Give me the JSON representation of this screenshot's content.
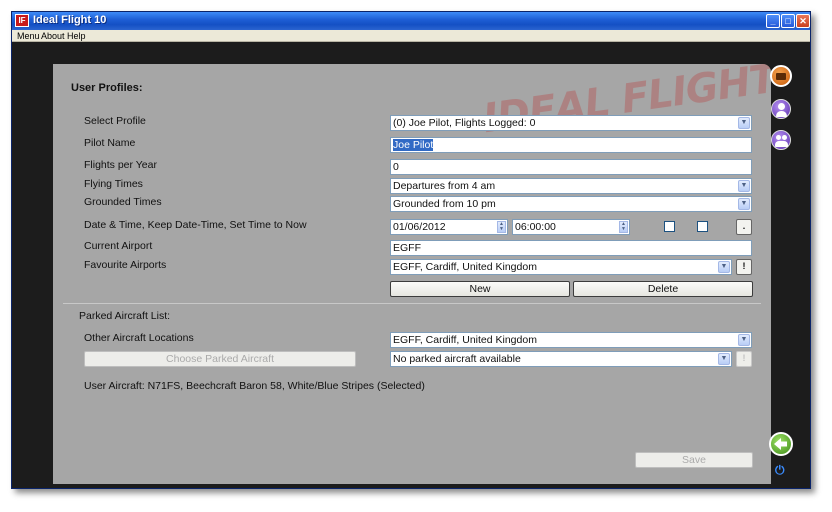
{
  "window": {
    "title": "Ideal Flight 10",
    "icon_text": "IF"
  },
  "menu": [
    "Menu",
    "About",
    "Help"
  ],
  "user_profiles": {
    "heading": "User Profiles:",
    "select_profile": {
      "label": "Select Profile",
      "value": "(0) Joe Pilot, Flights Logged: 0"
    },
    "pilot_name": {
      "label": "Pilot Name",
      "value": "Joe Pilot"
    },
    "flights_per_year": {
      "label": "Flights per Year",
      "value": "0"
    },
    "flying_times": {
      "label": "Flying Times",
      "value": "Departures from 4 am"
    },
    "grounded_times": {
      "label": "Grounded Times",
      "value": "Grounded from 10 pm"
    },
    "date_time": {
      "label": "Date & Time, Keep Date-Time, Set Time to Now",
      "date": "01/06/2012",
      "time": "06:00:00",
      "keep_checked": false,
      "set_now_checked": false,
      "dot_button": "."
    },
    "current_airport": {
      "label": "Current Airport",
      "value": "EGFF"
    },
    "favourite_airports": {
      "label": "Favourite Airports",
      "value": "EGFF, Cardiff, United Kingdom",
      "button": "!"
    },
    "new_button": "New",
    "delete_button": "Delete"
  },
  "parked": {
    "heading": "Parked Aircraft List:",
    "other_locations": {
      "label": "Other Aircraft Locations",
      "value": "EGFF, Cardiff, United Kingdom"
    },
    "choose_button": "Choose Parked Aircraft",
    "parked_select": {
      "value": "No parked aircraft available",
      "button": "!"
    },
    "user_aircraft": "User Aircraft: N71FS, Beechcraft Baron 58, White/Blue Stripes (Selected)"
  },
  "save_button": "Save",
  "logo_text": "IDEAL FLIGHT",
  "rail": [
    "folder-icon",
    "profile-icon",
    "crew-icon",
    "back-arrow-icon",
    "power-icon"
  ],
  "colors": {
    "panel": "#a6a6a6",
    "rail": "#1c1c1c",
    "accent_orange": "#e07a1c",
    "accent_purple": "#7a4fc8",
    "accent_green": "#55b52e"
  }
}
